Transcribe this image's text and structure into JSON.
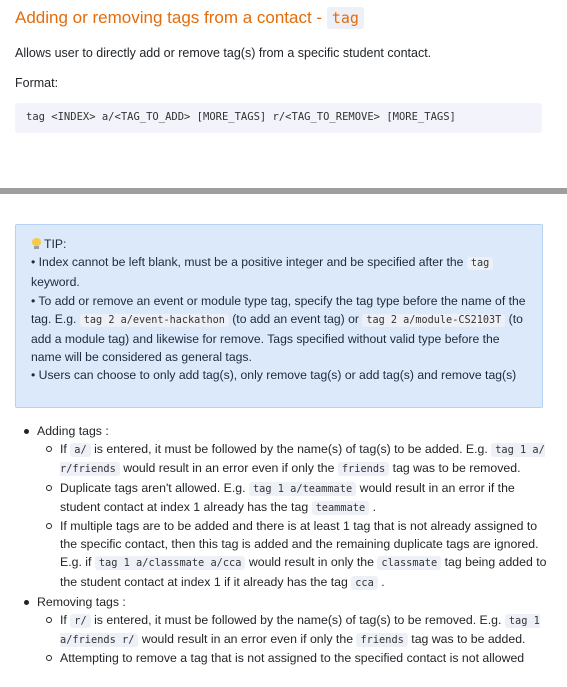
{
  "header": {
    "title": "Adding or removing tags from a contact - ",
    "title_code": "tag"
  },
  "description": "Allows user to directly add or remove tag(s) from a specific student contact.",
  "format": {
    "label": "Format:",
    "code": "tag <INDEX> a/<TAG_TO_ADD> [MORE_TAGS] r/<TAG_TO_REMOVE> [MORE_TAGS]"
  },
  "tip": {
    "title": "TIP:",
    "icon": "lightbulb-icon",
    "items": [
      {
        "t1": "• Index cannot be left blank, must be a positive integer and be specified after the ",
        "c1": "tag",
        "t2": " keyword."
      },
      {
        "t1": "• To add or remove an event or module type tag, specify the tag type before the name of the tag. E.g. ",
        "c1": "tag 2 a/event-hackathon",
        "t2": " (to add an event tag) or ",
        "c2": "tag 2 a/module-CS2103T",
        "t3": " (to add a module tag) and likewise for remove. Tags specified without valid type before the name will be considered as general tags."
      },
      {
        "t1": "• Users can choose to only add tag(s), only remove tag(s) or add tag(s) and remove tag(s)"
      }
    ]
  },
  "list": {
    "adding": {
      "label": "Adding tags :",
      "items": [
        {
          "t1": "If ",
          "c1": "a/",
          "t2": " is entered, it must be followed by the name(s) of tag(s) to be added. E.g. ",
          "c2": "tag 1 a/ r/friends",
          "t3": " would result in an error even if only the ",
          "c3": "friends",
          "t4": " tag was to be removed."
        },
        {
          "t1": "Duplicate tags aren't allowed. E.g. ",
          "c1": "tag 1 a/teammate",
          "t2": " would result in an error if the student contact at index 1 already has the tag ",
          "c2": "teammate",
          "t3": " ."
        },
        {
          "t1": "If multiple tags are to be added and there is at least 1 tag that is not already assigned to the specific contact, then this tag is added and the remaining duplicate tags are ignored. E.g. if ",
          "c1": "tag 1 a/classmate a/cca",
          "t2": " would result in only the ",
          "c2": "classmate",
          "t3": " tag being added to the student contact at index 1 if it already has the tag ",
          "c3": "cca",
          "t4": " ."
        }
      ]
    },
    "removing": {
      "label": "Removing tags :",
      "items": [
        {
          "t1": "If ",
          "c1": "r/",
          "t2": " is entered, it must be followed by the name(s) of tag(s) to be removed. E.g. ",
          "c2": "tag 1 a/friends r/",
          "t3": " would result in an error even if only the ",
          "c3": "friends",
          "t4": " tag was to be added."
        },
        {
          "t1": "Attempting to remove a tag that is not assigned to the specified contact is not allowed"
        }
      ]
    }
  }
}
